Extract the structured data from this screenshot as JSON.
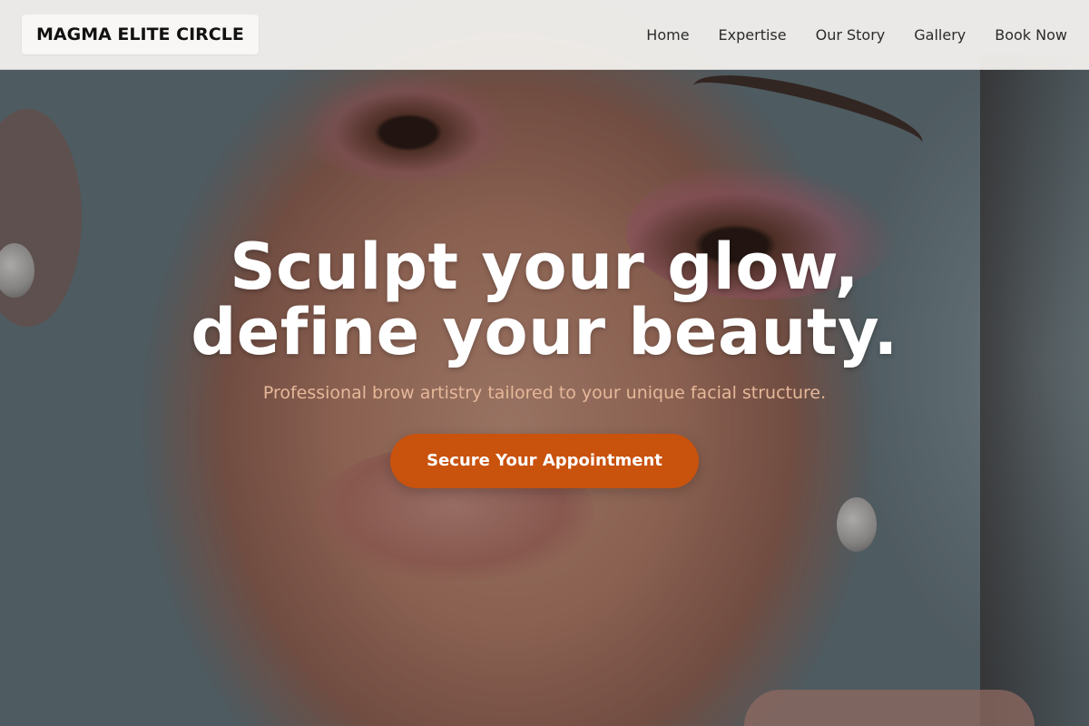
{
  "brand": {
    "name": "MAGMA ELITE CIRCLE"
  },
  "nav": {
    "items": [
      {
        "label": "Home"
      },
      {
        "label": "Expertise"
      },
      {
        "label": "Our Story"
      },
      {
        "label": "Gallery"
      },
      {
        "label": "Book Now"
      }
    ]
  },
  "hero": {
    "headline_line1": "Sculpt your glow,",
    "headline_line2": "define your beauty.",
    "subtitle": "Professional brow artistry tailored to your unique facial structure.",
    "cta_label": "Secure Your Appointment",
    "background_image": "close-up portrait of a woman with makeup"
  },
  "colors": {
    "accent": "#c9520d",
    "subtitle": "#e6b899",
    "nav_bg": "#f6f4f1"
  }
}
